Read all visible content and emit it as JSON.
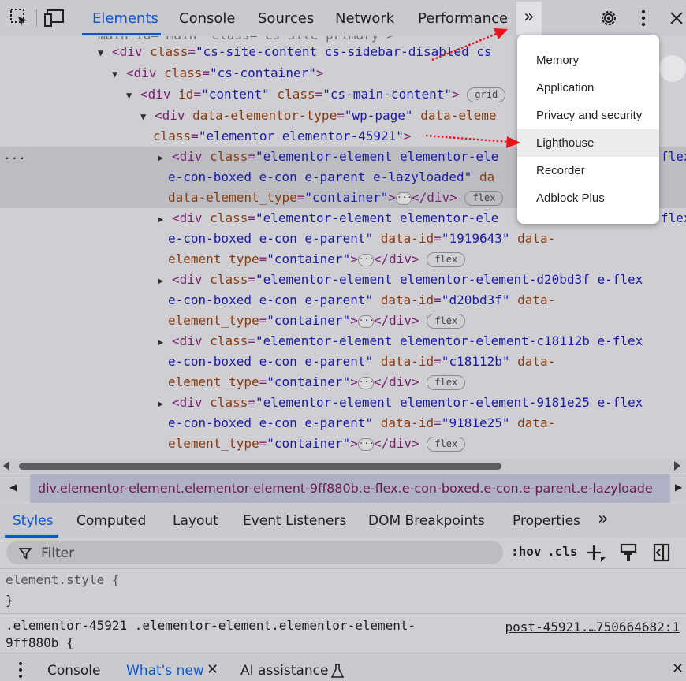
{
  "toolbar": {
    "tabs": [
      {
        "label": "Elements"
      },
      {
        "label": "Console"
      },
      {
        "label": "Sources"
      },
      {
        "label": "Network"
      },
      {
        "label": "Performance"
      }
    ],
    "more_tabs": "»"
  },
  "dom": {
    "lines": [
      {
        "text": "main id=\"main\" class=\"cs-site-primary\">"
      },
      {
        "tag_open": "<div ",
        "attr": "class",
        "value": "\"cs-site-content cs-sidebar-disabled cs"
      },
      {
        "tag_open": "<div ",
        "attr": "class",
        "value": "\"cs-container\"",
        "close": ">"
      },
      {
        "tag_open": "<div ",
        "attr": "id",
        "value": "\"content\"",
        "attr2": "class",
        "value2": "\"cs-main-content\"",
        "close": ">",
        "badge": "grid"
      },
      {
        "tag_open": "<div ",
        "attr": "data-elementor-type",
        "value": "\"wp-page\"",
        "attr2": "data-eleme"
      },
      {
        "attr": "class",
        "value": "\"elementor elementor-45921\"",
        "close": ">"
      }
    ],
    "children": [
      {
        "l1_attr": "class",
        "l1_value": "\"elementor-element elementor-ele",
        "l1_tail": "flex",
        "l2": "e-con-boxed e-con e-parent e-lazyloaded\"",
        "l2_tail": " da",
        "l3_attr": "data-element_type",
        "l3_value": "\"container\"",
        "badge": "flex"
      },
      {
        "l1_attr": "class",
        "l1_value": "\"elementor-element elementor-ele",
        "l1_tail": "flex",
        "l2": "e-con-boxed e-con e-parent\"",
        "l2_attr": "data-id",
        "l2_value": "\"1919643\"",
        "l2_tail": "data-",
        "l3_attr": "element_type",
        "l3_value": "\"container\"",
        "badge": "flex"
      },
      {
        "l1_attr": "class",
        "l1_value": "\"elementor-element elementor-element-d20bd3f e-flex",
        "l2": "e-con-boxed e-con e-parent\"",
        "l2_attr": "data-id",
        "l2_value": "\"d20bd3f\"",
        "l2_tail": "data-",
        "l3_attr": "element_type",
        "l3_value": "\"container\"",
        "badge": "flex"
      },
      {
        "l1_attr": "class",
        "l1_value": "\"elementor-element elementor-element-c18112b e-flex",
        "l2": "e-con-boxed e-con e-parent\"",
        "l2_attr": "data-id",
        "l2_value": "\"c18112b\"",
        "l2_tail": "data-",
        "l3_attr": "element_type",
        "l3_value": "\"container\"",
        "badge": "flex"
      },
      {
        "l1_attr": "class",
        "l1_value": "\"elementor-element elementor-element-9181e25 e-flex",
        "l2": "e-con-boxed e-con e-parent\"",
        "l2_attr": "data-id",
        "l2_value": "\"9181e25\"",
        "l2_tail": "data-",
        "l3_attr": "element_type",
        "l3_value": "\"container\"",
        "badge": "flex"
      }
    ],
    "gutter_dots": "...",
    "div_open": "<div ",
    "div_close": "</div>",
    "gt": ">",
    "ellipsis": "···"
  },
  "breadcrumb": "div.elementor-element.elementor-element-9ff880b.e-flex.e-con-boxed.e-con.e-parent.e-lazyloade",
  "lower_tabs": [
    {
      "label": "Styles"
    },
    {
      "label": "Computed"
    },
    {
      "label": "Layout"
    },
    {
      "label": "Event Listeners"
    },
    {
      "label": "DOM Breakpoints"
    },
    {
      "label": "Properties"
    }
  ],
  "lower_more": "»",
  "filter": {
    "placeholder": "Filter",
    "hov": ":hov",
    "cls": ".cls"
  },
  "styles": {
    "element_style": "element.style {",
    "close_brace": "}",
    "rule_selector_1": ".elementor-45921 .elementor-element.elementor-element-",
    "rule_selector_2": "9ff880b {",
    "rule_source": "post-45921.…750664682:1"
  },
  "drawer": {
    "tabs": [
      {
        "label": "Console"
      },
      {
        "label": "What's new"
      },
      {
        "label": "AI assistance"
      }
    ]
  },
  "menu": {
    "items": [
      {
        "label": "Memory"
      },
      {
        "label": "Application"
      },
      {
        "label": "Privacy and security"
      },
      {
        "label": "Lighthouse"
      },
      {
        "label": "Recorder"
      },
      {
        "label": "Adblock Plus"
      }
    ]
  },
  "colors": {
    "accent": "#0b57d0",
    "annotation_arrow": "#e8141a",
    "menu_hover": "#ececec"
  }
}
